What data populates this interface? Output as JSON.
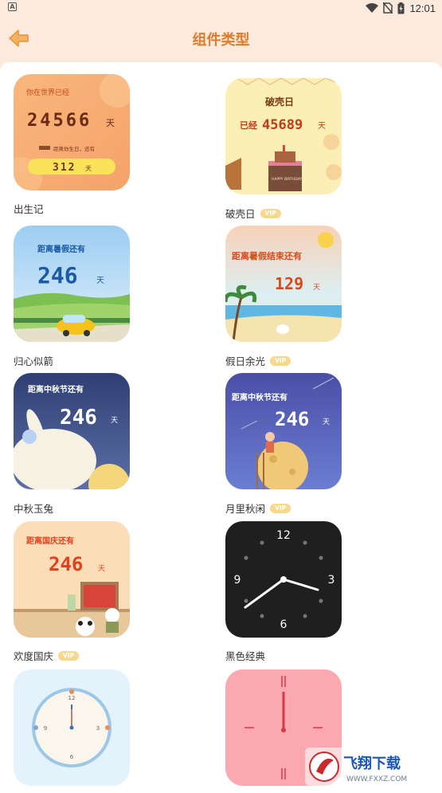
{
  "status_bar": {
    "left_icon": "A",
    "time": "12:01",
    "icons": [
      "wifi-icon",
      "no-sim-icon",
      "battery-charging-icon"
    ]
  },
  "header": {
    "title": "组件类型",
    "back_icon": "back-arrow-icon"
  },
  "widgets": [
    {
      "label": "出生记",
      "vip": false,
      "preview": {
        "line1": "你在世界已经",
        "number": "24566",
        "unit": "天",
        "line2": "距离你生日，还有",
        "number2": "312",
        "unit2": "天"
      }
    },
    {
      "label": "破壳日",
      "vip": true,
      "vip_text": "VIP",
      "preview": {
        "line1": "破壳日",
        "prefix": "已经",
        "number": "45689",
        "unit": "天",
        "cake_text": "HAPPY BIRTHDAY"
      }
    },
    {
      "label": "归心似箭",
      "vip": false,
      "preview": {
        "line1": "距离暑假还有",
        "number": "246",
        "unit": "天"
      }
    },
    {
      "label": "假日余光",
      "vip": true,
      "vip_text": "VIP",
      "preview": {
        "line1": "距离暑假结束还有",
        "number": "129",
        "unit": "天"
      }
    },
    {
      "label": "中秋玉兔",
      "vip": false,
      "preview": {
        "line1": "距离中秋节还有",
        "number": "246",
        "unit": "天"
      }
    },
    {
      "label": "月里秋闲",
      "vip": true,
      "vip_text": "VIP",
      "preview": {
        "line1": "距离中秋节还有",
        "number": "246",
        "unit": "天"
      }
    },
    {
      "label": "欢度国庆",
      "vip": true,
      "vip_text": "VIP",
      "preview": {
        "line1": "距离国庆还有",
        "number": "246",
        "unit": "天"
      }
    },
    {
      "label": "黑色经典",
      "vip": false,
      "preview": {
        "n12": "12",
        "n3": "3",
        "n6": "6",
        "n9": "9"
      }
    },
    {
      "label": "",
      "vip": false,
      "preview": {
        "n12": "12",
        "n3": "3",
        "n6": "6",
        "n9": "9"
      }
    },
    {
      "label": "",
      "vip": false,
      "preview": {}
    }
  ],
  "watermark": {
    "brand": "飞翔下载",
    "url": "WWW.FXXZ.COM"
  },
  "colors": {
    "accent": "#E07A2A",
    "header_bg": "#FCEBDD",
    "vip_bg": "#F7D88C"
  }
}
